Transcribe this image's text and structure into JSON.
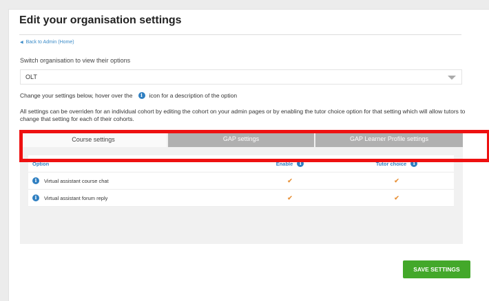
{
  "page": {
    "title": "Edit your organisation settings",
    "back_link": "Back to Admin (Home)",
    "switch_label": "Switch organisation to view their options",
    "organisation_select": {
      "value": "OLT"
    },
    "info_text_before": "Change your settings below, hover over the",
    "info_text_after": "icon for a description of the option",
    "override_paragraph": "All settings can be overriden for an individual cohort by editing the cohort on your admin pages or by enabling the tutor choice option for that setting which will allow tutors to change that setting for each of their cohorts."
  },
  "tabs": [
    {
      "label": "Course settings",
      "active": true
    },
    {
      "label": "GAP settings",
      "active": false
    },
    {
      "label": "GAP Learner Profile settings",
      "active": false
    }
  ],
  "table": {
    "headers": {
      "option": "Option",
      "enable": "Enable",
      "tutor_choice": "Tutor choice"
    },
    "rows": [
      {
        "label": "Virtual assistant course chat",
        "enable": true,
        "tutor_choice": true,
        "check": "✔"
      },
      {
        "label": "Virtual assistant forum reply",
        "enable": true,
        "tutor_choice": true,
        "check": "✔"
      }
    ]
  },
  "save_button": "SAVE SETTINGS",
  "icons": {
    "info": "info-icon",
    "back": "back-arrow-icon",
    "dropdown": "chevron-down-icon",
    "check": "checkmark-icon"
  },
  "colors": {
    "accent": "#2f7fc1",
    "save": "#43a82a",
    "highlight": "#ee1111",
    "check": "#e8923a",
    "tab_inactive": "#b0b0b0"
  }
}
